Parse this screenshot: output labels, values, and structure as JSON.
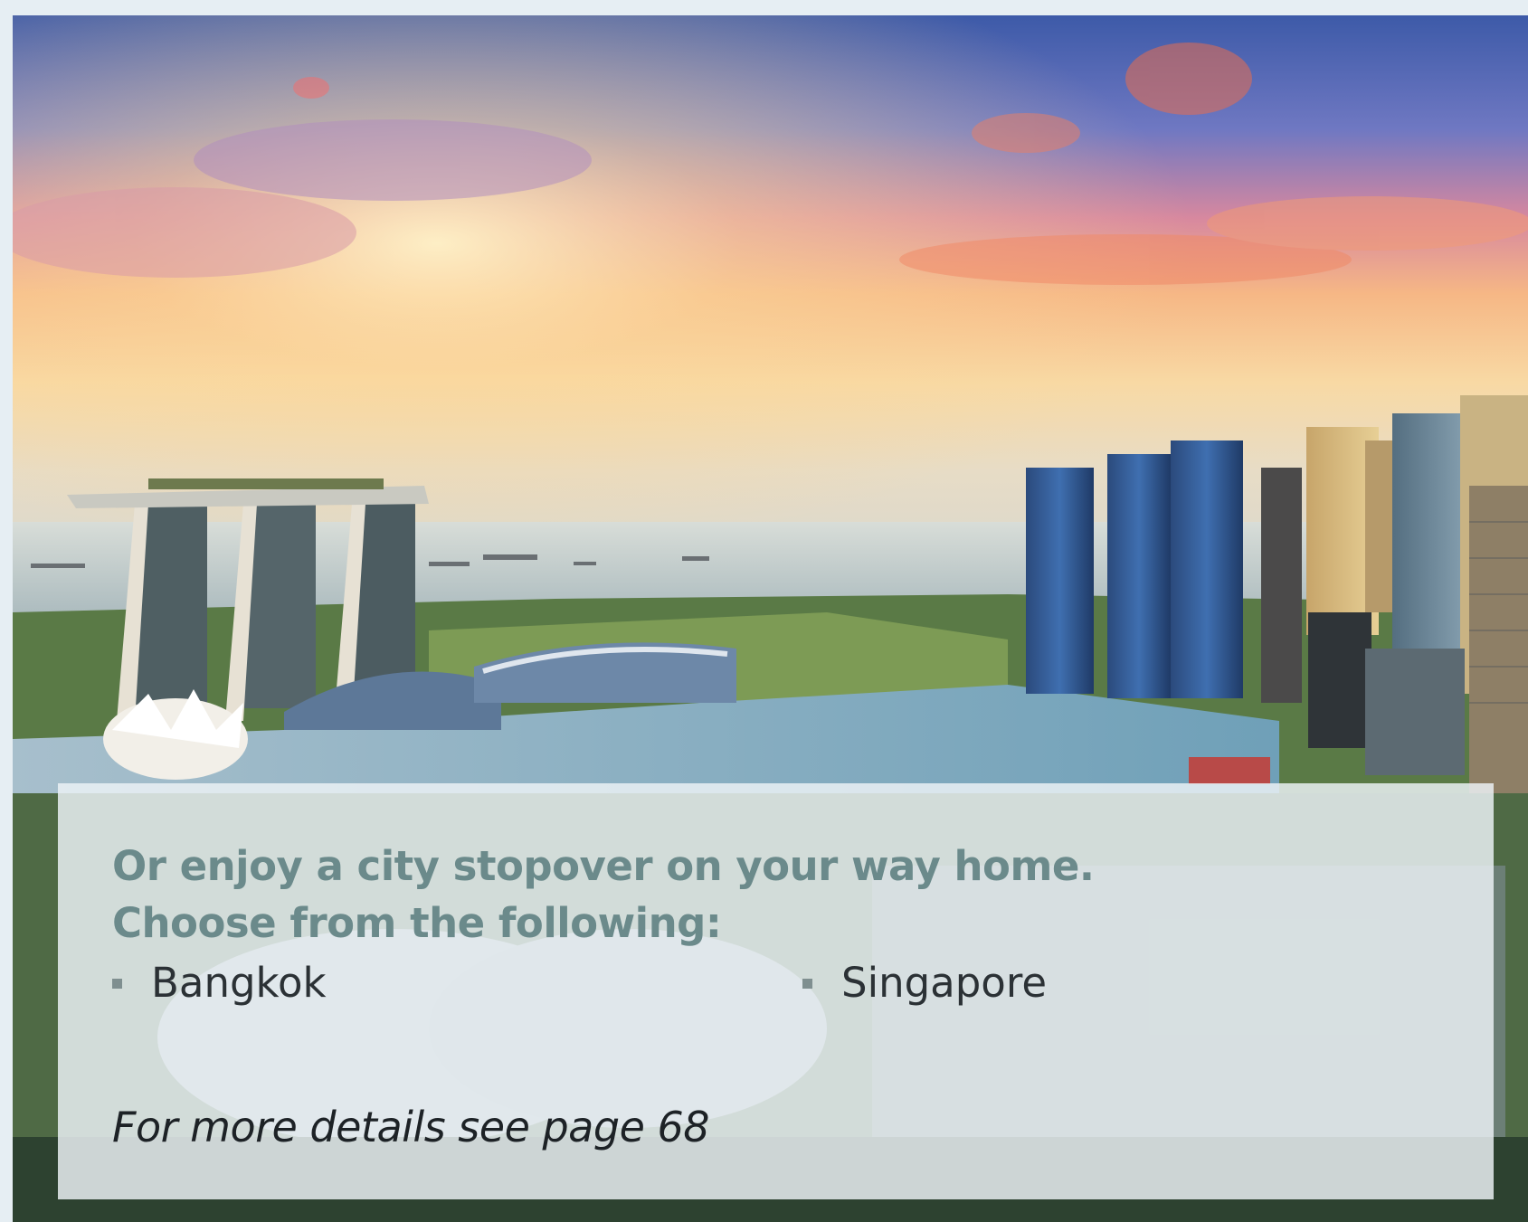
{
  "panel": {
    "heading_line1": "Or enjoy a city stopover on your way home.",
    "heading_line2": "Choose from the following:",
    "cities": [
      "Bangkok",
      "Singapore"
    ],
    "footnote": "For more details see page 68"
  },
  "colors": {
    "heading": "#6b8a8b",
    "body_text": "#2b3135",
    "panel_bg": "#ecf2f5",
    "page_bg": "#e6eef3"
  },
  "image": {
    "subject": "singapore-skyline-photo"
  }
}
